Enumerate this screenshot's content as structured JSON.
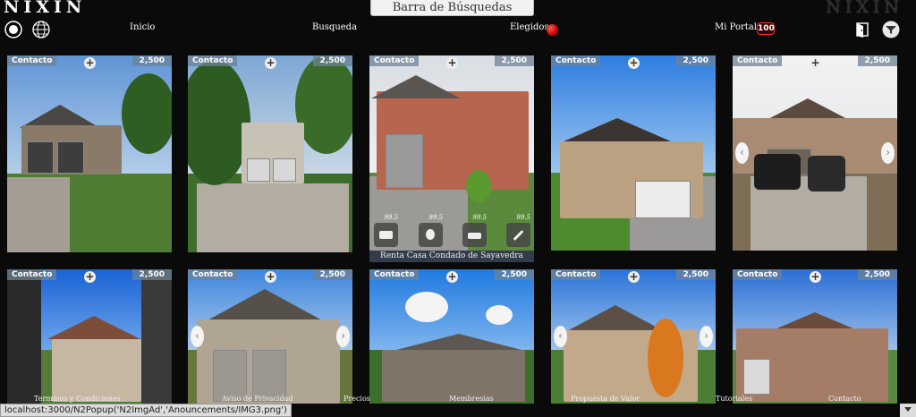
{
  "header": {
    "logo_left": "NIXIN",
    "logo_right": "NIXIN",
    "search_label": "Barra de Búsquedas",
    "nav": {
      "inicio": "Inicio",
      "busqueda": "Busqueda",
      "elegidos": "Elegidos",
      "mi_portal": "Mi Portal",
      "mi_portal_count": "100"
    },
    "icons": [
      "radio-icon",
      "globe-icon",
      "door-icon",
      "filter-icon"
    ]
  },
  "listings": [
    {
      "contact": "Contacto",
      "price": "2,500"
    },
    {
      "contact": "Contacto",
      "price": "2,500"
    },
    {
      "contact": "Contacto",
      "price": "2,500",
      "caption": "Renta Casa Condado de Sayavedra",
      "amenity_values": [
        "99.5",
        "99.5",
        "99.5",
        "99.5"
      ]
    },
    {
      "contact": "Contacto",
      "price": "2,500"
    },
    {
      "contact": "Contacto",
      "price": "2,500"
    },
    {
      "contact": "Contacto",
      "price": "2,500"
    },
    {
      "contact": "Contacto",
      "price": "2,500"
    },
    {
      "contact": "Contacto",
      "price": "2,500"
    },
    {
      "contact": "Contacto",
      "price": "2,500"
    },
    {
      "contact": "Contacto",
      "price": "2,500"
    }
  ],
  "footer": {
    "terminos": "Terminos y Condiciones",
    "aviso": "Aviso de Privacidad",
    "precios": "Precios",
    "membresias": "Membresias",
    "propuesta": "Propuesta de Valor",
    "tutoriales": "Tutoriales",
    "contacto": "Contacto"
  },
  "status_url": "localhost:3000/N2Popup('N2ImgAd','Anouncements/IMG3.png')"
}
